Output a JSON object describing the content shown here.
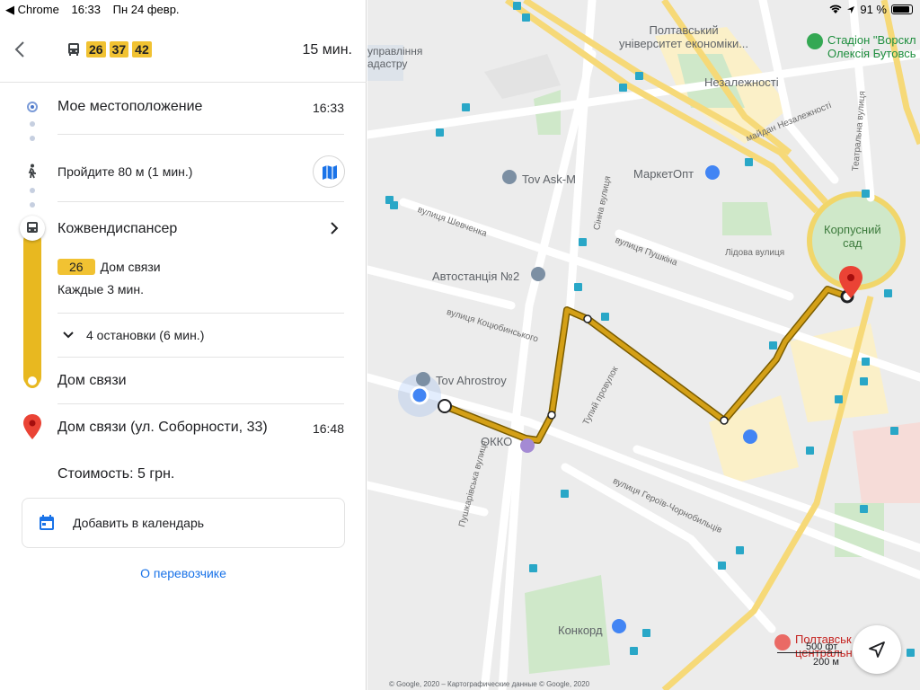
{
  "status_bar": {
    "app": "◀ Chrome",
    "time": "16:33",
    "date": "Пн 24 февр.",
    "battery": "91 %"
  },
  "header": {
    "routes": [
      "26",
      "37",
      "42"
    ],
    "total_time": "15 мин."
  },
  "steps": {
    "origin": {
      "label": "Мое местоположение",
      "time": "16:33"
    },
    "walk": {
      "label": "Пройдите 80 м (1 мин.)"
    },
    "bus_stop": {
      "label": "Кожвендиспансер"
    },
    "bus_line": {
      "number": "26",
      "direction": "Дом связи",
      "frequency": "Каждые 3 мин."
    },
    "stops": {
      "label": "4 остановки (6 мин.)"
    },
    "alight": {
      "label": "Дом связи"
    },
    "destination": {
      "label": "Дом связи (ул. Соборности, 33)",
      "time": "16:48"
    }
  },
  "cost": "Стоимость: 5 грн.",
  "calendar": {
    "label": "Добавить в календарь"
  },
  "carrier_link": "О перевозчике",
  "map": {
    "labels": {
      "poltava_univ": "Полтавський\nуніверситет економіки...",
      "stadium": "Стадіон \"Ворскл\nОлексія Бутовсь",
      "nezalezhnosti": "Незалежності",
      "maidan": "майдан Незалежності",
      "upravlinnya": "управління\nадастру",
      "tov_ask": "Tov Ask-M",
      "marketopt": "МаркетОпт",
      "korpusnyi": "Корпусний\nсад",
      "avtostantsia": "Автостанція №2",
      "tov_ahrostroy": "Tov Ahrostroy",
      "okko": "ОККО",
      "konkord": "Конкорд",
      "poltavskyi": "Полтавськ\nцентральн",
      "shevchenka": "вулиця Шевченка",
      "pushkina": "вулиця Пушкіна",
      "sinna": "Сінна вулиця",
      "lidova": "Лідова вулиця",
      "kotsiubynskoho": "вулиця Коцюбинського",
      "tupyi": "Тупий провулок",
      "heroiv": "вулиця Героїв-Чорнобильців",
      "pushkarivska": "Пушкарівська вулиця",
      "teatralna": "Театральна вулиця"
    },
    "copyright": "© Google, 2020 – Картографические данные © Google, 2020",
    "scale_ft": "500 фт",
    "scale_m": "200 м"
  },
  "colors": {
    "route_yellow": "#d4a017",
    "link_blue": "#1a73e8",
    "pin_red": "#ea4335"
  }
}
